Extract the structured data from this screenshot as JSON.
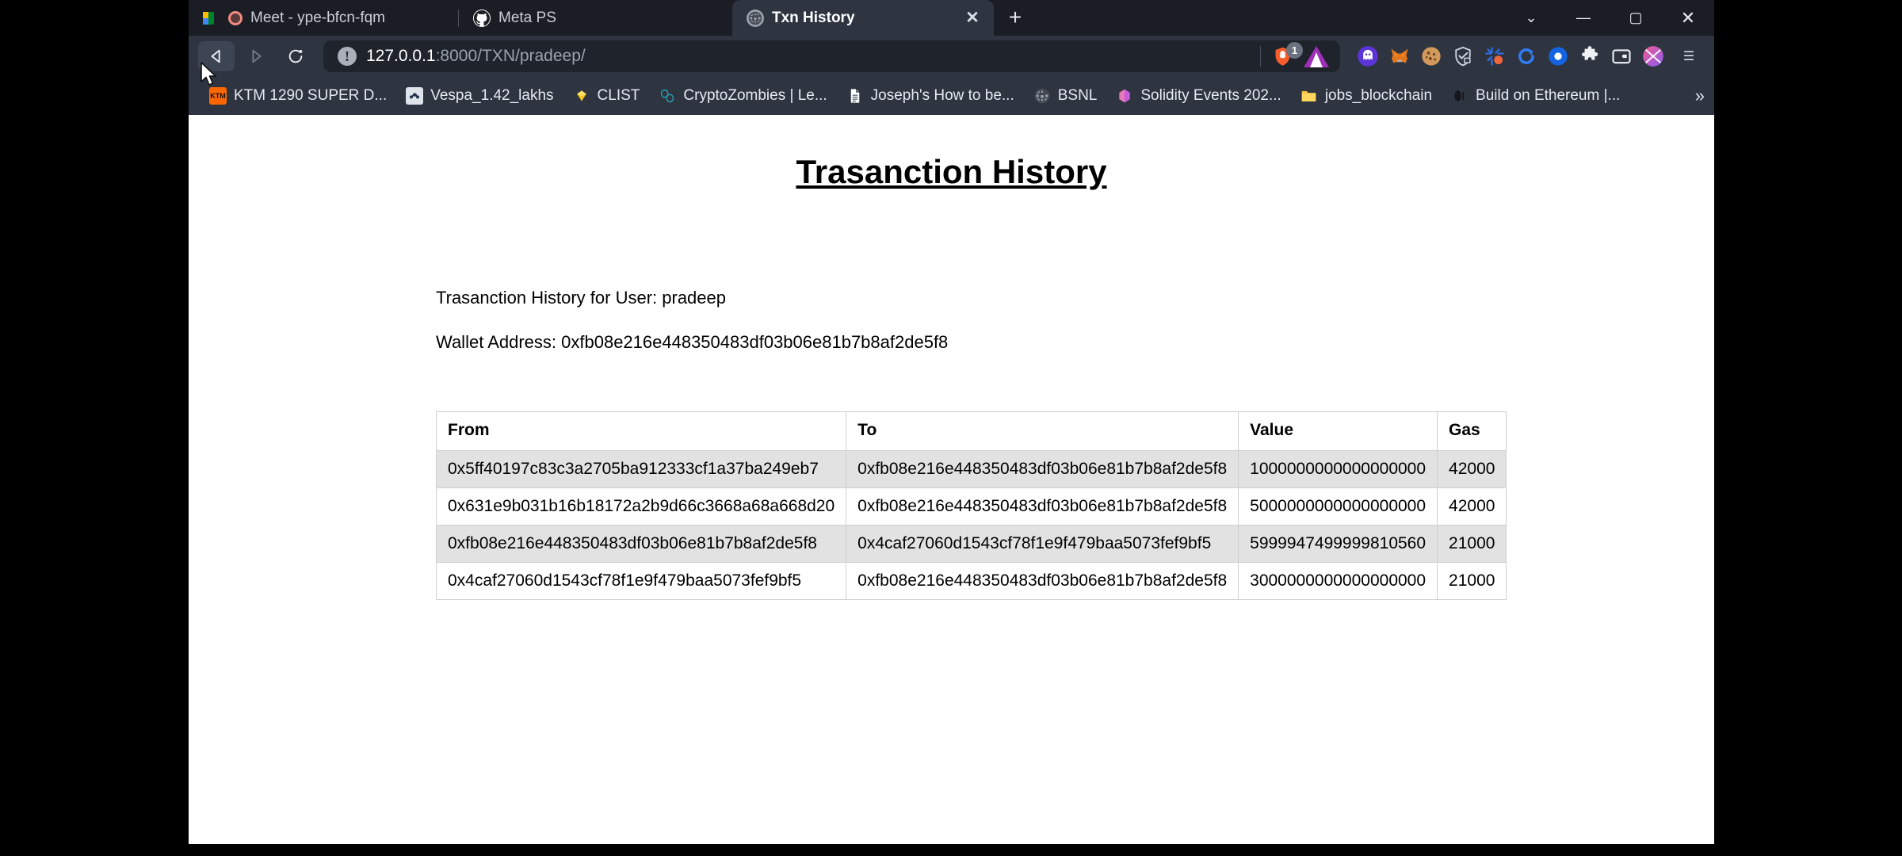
{
  "window": {
    "controls": {
      "minimize": "—",
      "maximize": "▢",
      "close": "✕",
      "chevron": "⌄"
    }
  },
  "tabs": [
    {
      "label": "Meet - ype-bfcn-fqm",
      "icon": "google-meet-icon",
      "active": false
    },
    {
      "label": "Meta PS",
      "icon": "github-icon",
      "active": false
    },
    {
      "label": "Txn History",
      "icon": "globe-icon",
      "active": true,
      "close": "✕"
    }
  ],
  "newtab_label": "+",
  "toolbar": {
    "back": "◁",
    "forward": "▷",
    "reload": "⟳",
    "bookmark_star": "🔖",
    "menu": "☰",
    "brave_shield_badge": "1",
    "extensions": [
      "ghost-extension-icon",
      "metamask-fox-icon",
      "cookie-icon",
      "shield-lock-icon",
      "burst-icon",
      "blue-refresh-icon",
      "blue-dot-icon",
      "puzzle-piece-icon",
      "wallet-icon",
      "gradient-circle-icon"
    ]
  },
  "url": {
    "host": "127.0.0.1",
    "rest": ":8000/TXN/pradeep/",
    "full": "127.0.0.1:8000/TXN/pradeep/",
    "info_glyph": "!"
  },
  "bookmarks": {
    "items": [
      {
        "label": "KTM 1290 SUPER D...",
        "icon": "ktm-icon"
      },
      {
        "label": "Vespa_1.42_lakhs",
        "icon": "vespa-icon"
      },
      {
        "label": "CLIST",
        "icon": "clist-icon"
      },
      {
        "label": "CryptoZombies | Le...",
        "icon": "cryptozombies-icon"
      },
      {
        "label": "Joseph's How to be...",
        "icon": "document-icon"
      },
      {
        "label": "BSNL",
        "icon": "globe-icon"
      },
      {
        "label": "Solidity Events 202...",
        "icon": "notion-hex-icon"
      },
      {
        "label": "jobs_blockchain",
        "icon": "folder-icon"
      },
      {
        "label": "Build on Ethereum |...",
        "icon": "ethereum-icon"
      }
    ],
    "overflow": "»"
  },
  "page": {
    "title": "Trasanction History",
    "user_line": "Trasanction History for User: pradeep",
    "wallet_line": "Wallet Address: 0xfb08e216e448350483df03b06e81b7b8af2de5f8",
    "table": {
      "headers": [
        "From",
        "To",
        "Value",
        "Gas"
      ],
      "rows": [
        {
          "from": "0x5ff40197c83c3a2705ba912333cf1a37ba249eb7",
          "to": "0xfb08e216e448350483df03b06e81b7b8af2de5f8",
          "value": "1000000000000000000",
          "gas": "42000"
        },
        {
          "from": "0x631e9b031b16b18172a2b9d66c3668a68a668d20",
          "to": "0xfb08e216e448350483df03b06e81b7b8af2de5f8",
          "value": "5000000000000000000",
          "gas": "42000"
        },
        {
          "from": "0xfb08e216e448350483df03b06e81b7b8af2de5f8",
          "to": "0x4caf27060d1543cf78f1e9f479baa5073fef9bf5",
          "value": "5999947499999810560",
          "gas": "21000"
        },
        {
          "from": "0x4caf27060d1543cf78f1e9f479baa5073fef9bf5",
          "to": "0xfb08e216e448350483df03b06e81b7b8af2de5f8",
          "value": "3000000000000000000",
          "gas": "21000"
        }
      ]
    }
  }
}
